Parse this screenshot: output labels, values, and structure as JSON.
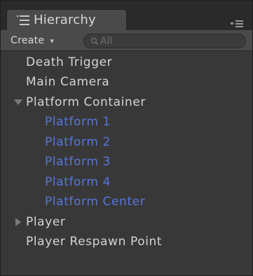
{
  "panel": {
    "tab_title": "Hierarchy",
    "create_label": "Create",
    "create_caret": "▾",
    "search": {
      "placeholder": "All",
      "value": ""
    }
  },
  "tree": {
    "items": [
      {
        "label": "Death Trigger"
      },
      {
        "label": "Main Camera"
      },
      {
        "label": "Platform Container",
        "expanded": true
      },
      {
        "label": "Platform 1",
        "selected_color": true
      },
      {
        "label": "Platform 2",
        "selected_color": true
      },
      {
        "label": "Platform 3",
        "selected_color": true
      },
      {
        "label": "Platform 4",
        "selected_color": true
      },
      {
        "label": "Platform Center",
        "selected_color": true
      },
      {
        "label": "Player",
        "expanded": false
      },
      {
        "label": "Player Respawn Point"
      }
    ]
  },
  "colors": {
    "panel_background": "#383838",
    "item_text": "#d4d4d4",
    "child_text": "#5677d8"
  },
  "icons": {
    "tab": "list-icon",
    "menu": "panel-menu-icon",
    "search": "search-icon",
    "expanded": "triangle-down-icon",
    "collapsed": "triangle-right-icon"
  }
}
